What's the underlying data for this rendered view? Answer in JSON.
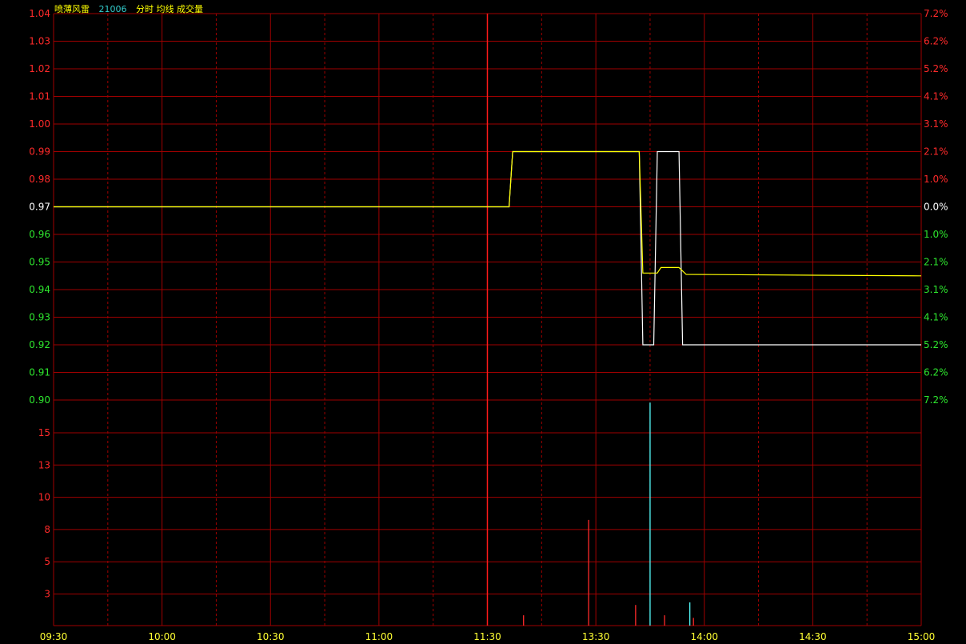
{
  "header": {
    "name": "喷薄风雷",
    "code": "21006",
    "view": "分时 均线 成交量"
  },
  "colors": {
    "background": "#000000",
    "grid": "#a00000",
    "up": "#ff2a2a",
    "down": "#2ee62e",
    "neutral": "#ffffff",
    "price_line": "#ffffff",
    "avg_line": "#ffff00",
    "volume_up": "#ff2a2a",
    "volume_down": "#55ffff",
    "header_name": "#ffff00",
    "header_code": "#33cccc",
    "header_view": "#ffff00",
    "time_label": "#ffff33"
  },
  "chart_data": [
    {
      "type": "line",
      "title": "",
      "base_price": 0.97,
      "ylim": [
        0.9,
        1.04
      ],
      "price_ticks": [
        "1.04",
        "1.03",
        "1.02",
        "1.01",
        "1.00",
        "0.99",
        "0.98",
        "0.97",
        "0.96",
        "0.95",
        "0.94",
        "0.93",
        "0.92",
        "0.91",
        "0.90"
      ],
      "pct_ticks": [
        "7.2%",
        "6.2%",
        "5.2%",
        "4.1%",
        "3.1%",
        "2.1%",
        "1.0%",
        "0.0%",
        "1.0%",
        "2.1%",
        "3.1%",
        "4.1%",
        "5.2%",
        "6.2%",
        "7.2%"
      ],
      "x_ticks": [
        "09:30",
        "10:00",
        "10:30",
        "11:00",
        "11:30",
        "13:30",
        "14:00",
        "14:30",
        "15:00"
      ],
      "grid": true,
      "series": [
        {
          "key": "price",
          "points": [
            [
              "09:30",
              0.97
            ],
            [
              "11:30",
              0.97
            ],
            [
              "13:06",
              0.97
            ],
            [
              "13:07",
              0.99
            ],
            [
              "13:42",
              0.99
            ],
            [
              "13:43",
              0.92
            ],
            [
              "13:46",
              0.92
            ],
            [
              "13:47",
              0.99
            ],
            [
              "13:53",
              0.99
            ],
            [
              "13:54",
              0.92
            ],
            [
              "15:00",
              0.92
            ]
          ]
        },
        {
          "key": "average",
          "points": [
            [
              "09:30",
              0.97
            ],
            [
              "11:30",
              0.97
            ],
            [
              "13:06",
              0.97
            ],
            [
              "13:07",
              0.99
            ],
            [
              "13:42",
              0.99
            ],
            [
              "13:43",
              0.946
            ],
            [
              "13:47",
              0.946
            ],
            [
              "13:48",
              0.948
            ],
            [
              "13:53",
              0.948
            ],
            [
              "13:55",
              0.9455
            ],
            [
              "15:00",
              0.945
            ]
          ]
        }
      ]
    },
    {
      "type": "bar",
      "title": "",
      "ylim": [
        0,
        17.5
      ],
      "y_ticks": [
        "15",
        "13",
        "10",
        "8",
        "5",
        "3"
      ],
      "bars": [
        {
          "time": "13:10",
          "value": 0.8,
          "dir": "up"
        },
        {
          "time": "13:28",
          "value": 8.2,
          "dir": "up"
        },
        {
          "time": "13:41",
          "value": 1.6,
          "dir": "up"
        },
        {
          "time": "13:45",
          "value": 17.3,
          "dir": "down"
        },
        {
          "time": "13:49",
          "value": 0.8,
          "dir": "up"
        },
        {
          "time": "13:56",
          "value": 1.8,
          "dir": "down"
        },
        {
          "time": "13:57",
          "value": 0.6,
          "dir": "up"
        }
      ]
    }
  ]
}
